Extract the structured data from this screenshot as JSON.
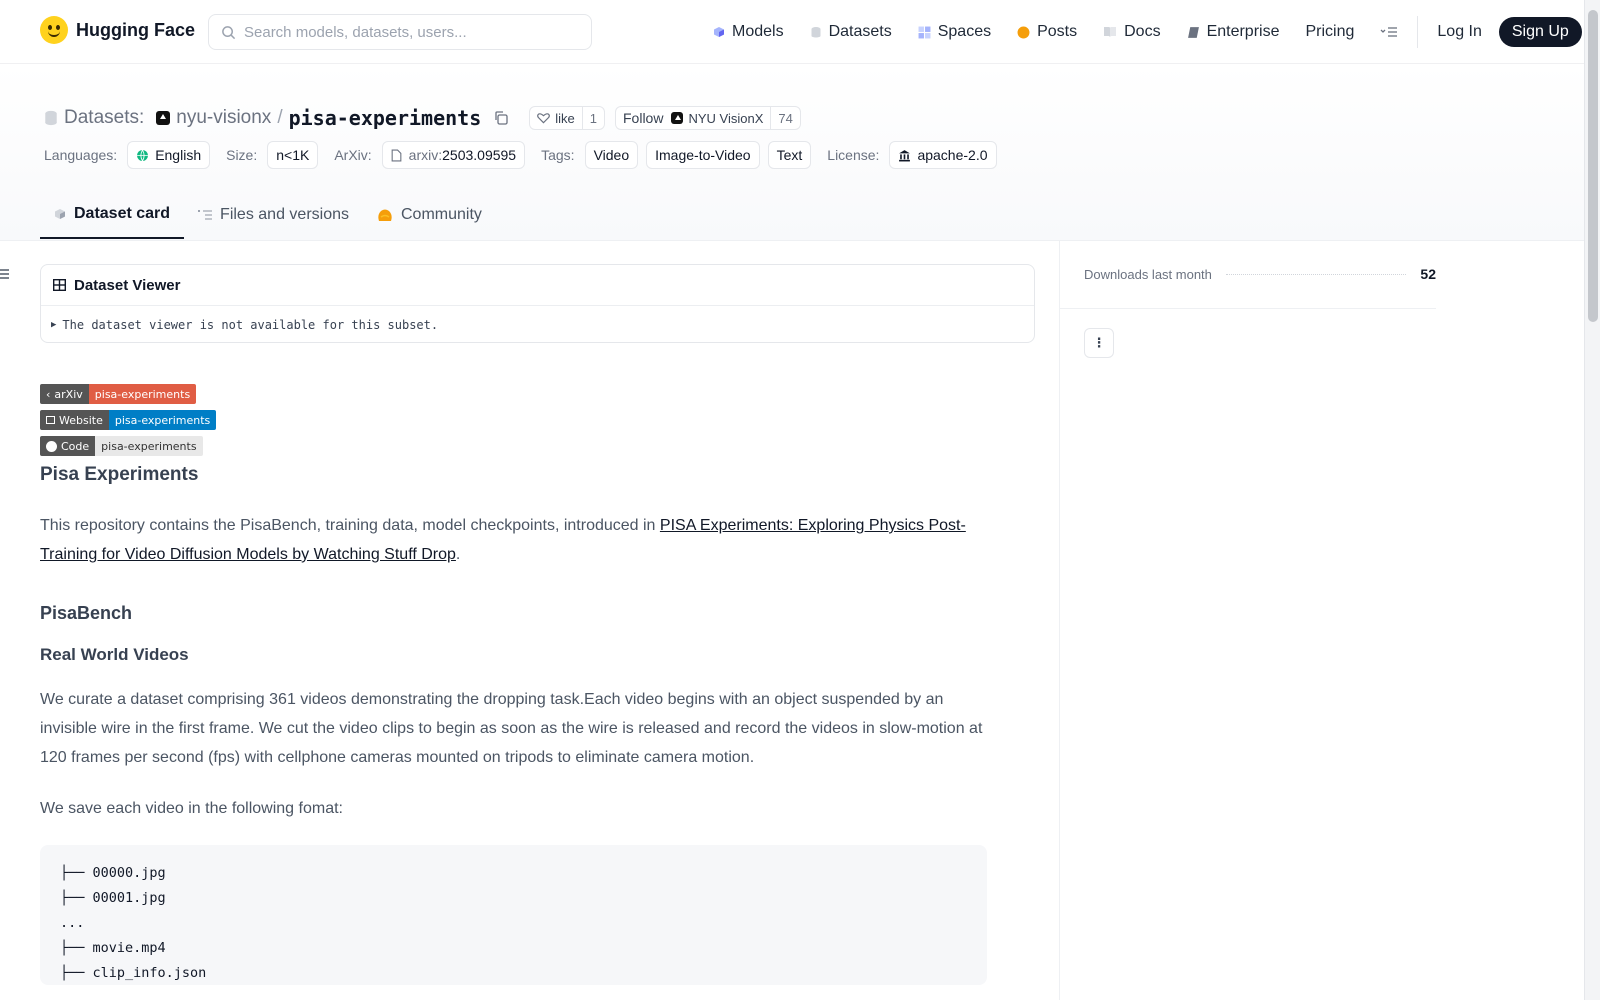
{
  "nav": {
    "brand": "Hugging Face",
    "search_placeholder": "Search models, datasets, users...",
    "links": [
      "Models",
      "Datasets",
      "Spaces",
      "Posts",
      "Docs",
      "Enterprise",
      "Pricing"
    ],
    "login": "Log In",
    "signup": "Sign Up"
  },
  "header": {
    "section": "Datasets:",
    "org": "nyu-visionx",
    "repo": "pisa-experiments",
    "like_label": "like",
    "like_count": "1",
    "follow_label": "Follow",
    "follow_org": "NYU VisionX",
    "follow_count": "74",
    "meta": {
      "languages_key": "Languages:",
      "language": "English",
      "size_key": "Size:",
      "size": "n<1K",
      "arxiv_key": "ArXiv:",
      "arxiv_prefix": "arxiv:",
      "arxiv_id": "2503.09595",
      "tags_key": "Tags:",
      "tags": [
        "Video",
        "Image-to-Video",
        "Text"
      ],
      "license_key": "License:",
      "license": "apache-2.0"
    },
    "tabs": [
      "Dataset card",
      "Files and versions",
      "Community"
    ]
  },
  "viewer": {
    "title": "Dataset Viewer",
    "message": "The dataset viewer is not available for this subset."
  },
  "badges": [
    {
      "left": "arXiv",
      "right": "pisa-experiments",
      "color": "#e05d44"
    },
    {
      "left": "Website",
      "right": "pisa-experiments",
      "color": "#007ec6"
    },
    {
      "left": "Code",
      "right": "pisa-experiments",
      "color": "#e8e8e8"
    }
  ],
  "content": {
    "title": "Pisa Experiments",
    "intro_before": "This repository contains the PisaBench, training data, model checkpoints, introduced in ",
    "intro_link": "PISA Experiments: Exploring Physics Post-Training for Video Diffusion Models by Watching Stuff Drop",
    "intro_after": ".",
    "h_pisabench": "PisaBench",
    "h_realworld": "Real World Videos",
    "para_curate": "We curate a dataset comprising 361 videos demonstrating the dropping task.Each video begins with an object suspended by an invisible wire in the first frame. We cut the video clips to begin as soon as the wire is released and record the videos in slow-motion at 120 frames per second (fps) with cellphone cameras mounted on tripods to eliminate camera motion.",
    "para_format": "We save each video in the following fomat:",
    "code_lines": [
      "├── 00000.jpg",
      "├── 00001.jpg",
      "...",
      "├── movie.mp4",
      "├── clip_info.json"
    ]
  },
  "sidebar": {
    "downloads_label": "Downloads last month",
    "downloads_value": "52"
  },
  "colors": {
    "accent_dark": "#111827",
    "brand_yellow": "#ffd21e"
  }
}
